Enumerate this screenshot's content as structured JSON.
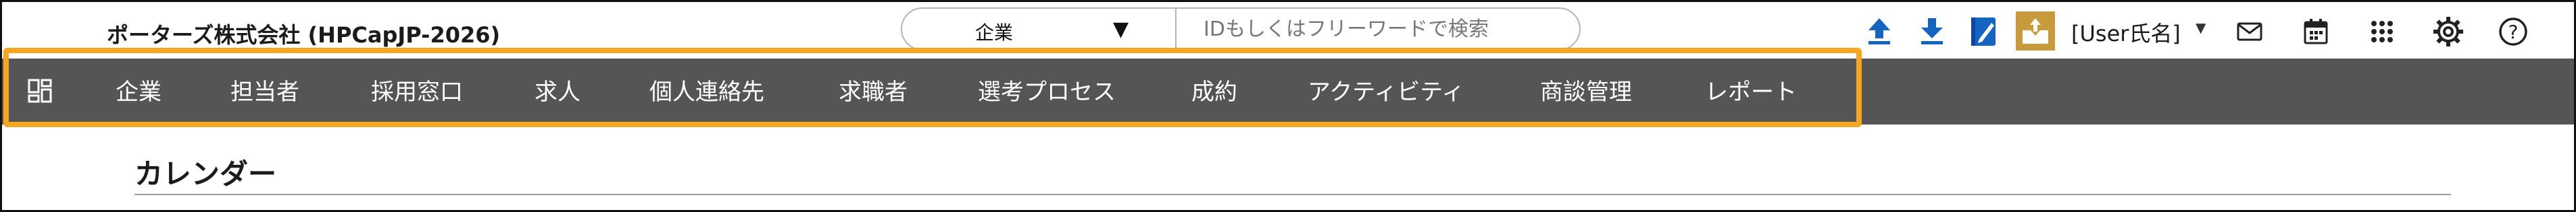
{
  "header": {
    "company_name": "ポーターズ株式会社 (HPCapJP-2026)",
    "search": {
      "selected_type": "企業",
      "placeholder": "IDもしくはフリーワードで検索"
    },
    "user_label": "[User氏名]",
    "icons": [
      "upload-icon",
      "download-icon",
      "notebook-icon",
      "inbox-icon",
      "mail-icon",
      "calendar-icon",
      "apps-grid-icon",
      "settings-gear-icon",
      "help-icon"
    ]
  },
  "nav": {
    "items": [
      "企業",
      "担当者",
      "採用窓口",
      "求人",
      "個人連絡先",
      "求職者",
      "選考プロセス",
      "成約",
      "アクティビティ",
      "商談管理",
      "レポート"
    ]
  },
  "main": {
    "title": "カレンダー"
  },
  "colors": {
    "nav_bg": "#555555",
    "highlight": "#f5a623",
    "accent_blue": "#1565c0",
    "inbox_gold": "#c89a3c"
  }
}
